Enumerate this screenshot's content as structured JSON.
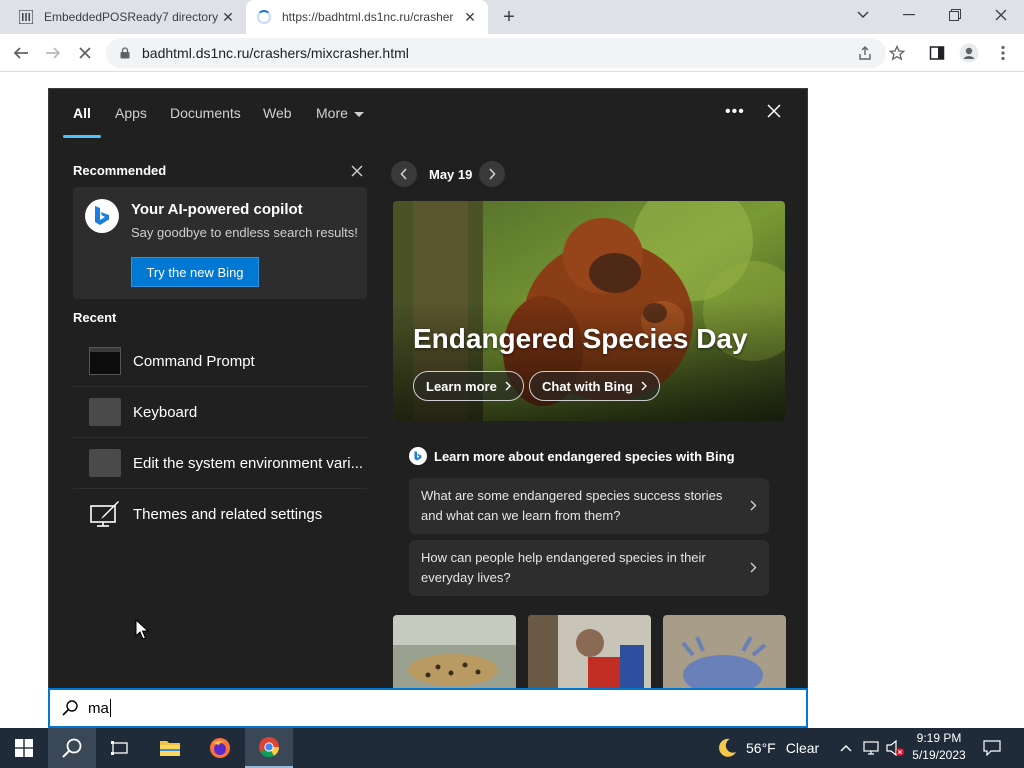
{
  "browser": {
    "tabs": [
      {
        "title": "EmbeddedPOSReady7 directory |",
        "state": "inactive"
      },
      {
        "title": "https://badhtml.ds1nc.ru/crasher",
        "state": "loading"
      }
    ],
    "new_tab": "+",
    "url": "badhtml.ds1nc.ru/crashers/mixcrasher.html"
  },
  "search_panel": {
    "filters": [
      "All",
      "Apps",
      "Documents",
      "Web",
      "More"
    ],
    "active_filter": "All",
    "recommended": {
      "heading": "Recommended",
      "card": {
        "title": "Your AI-powered copilot",
        "subtitle": "Say goodbye to endless search results!",
        "button": "Try the new Bing"
      }
    },
    "recent": {
      "heading": "Recent",
      "items": [
        {
          "label": "Command Prompt",
          "icon": "command-prompt-icon"
        },
        {
          "label": "Keyboard",
          "icon": "keyboard-icon"
        },
        {
          "label": "Edit the system environment vari...",
          "icon": "control-panel-icon"
        },
        {
          "label": "Themes and related settings",
          "icon": "themes-icon"
        }
      ]
    },
    "highlight": {
      "date": "May 19",
      "title": "Endangered Species Day",
      "buttons": [
        "Learn more",
        "Chat with Bing"
      ],
      "learn_heading": "Learn more about endangered species with Bing",
      "questions": [
        "What are some endangered species success stories and what can we learn from them?",
        "How can people help endangered species in their everyday lives?"
      ]
    },
    "search_query": "ma"
  },
  "taskbar": {
    "weather": {
      "temp": "56°F",
      "condition": "Clear"
    },
    "clock": {
      "time": "9:19 PM",
      "date": "5/19/2023"
    }
  },
  "colors": {
    "panel_bg": "#202020",
    "accent": "#0078d4",
    "taskbar_bg": "#1f2b38",
    "tab_underline": "#4cc2ff"
  }
}
